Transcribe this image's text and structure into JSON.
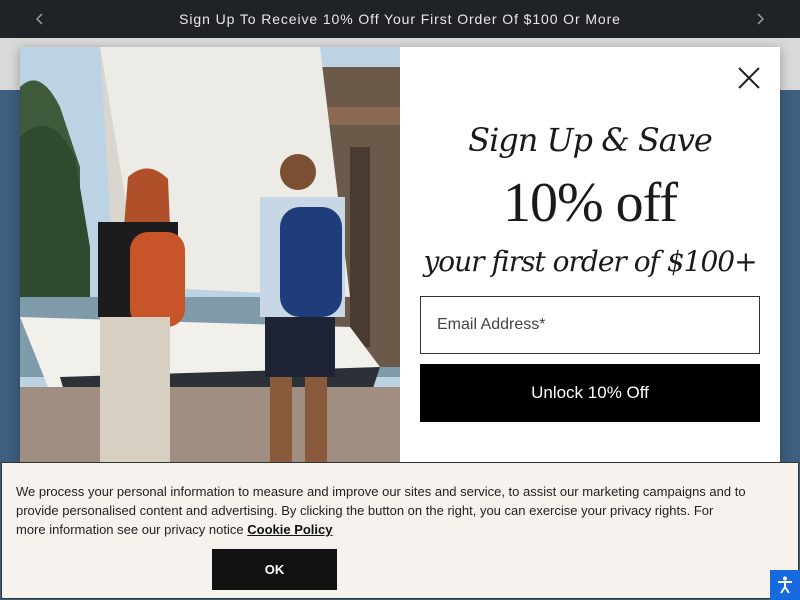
{
  "announcement": {
    "text": "Sign Up To Receive 10% Off Your First Order Of $100 Or More",
    "prev_icon": "chevron-left-icon",
    "next_icon": "chevron-right-icon"
  },
  "modal": {
    "headline": "Sign Up & Save",
    "offer": "10% off",
    "subline": "your first order of $100+",
    "email_placeholder": "Email Address*",
    "submit_label": "Unlock 10% Off",
    "close_icon": "close-icon"
  },
  "cookie_banner": {
    "text": "We process your personal information to measure and improve our sites and service, to assist our marketing campaigns and to provide personalised content and advertising. By clicking the button on the right, you can exercise your privacy rights. For more information see our privacy notice",
    "link_label": "Cookie Policy",
    "ok_label": "OK"
  },
  "accessibility_icon": "accessibility-icon",
  "colors": {
    "announcement_bg": "#1f2328",
    "button_bg": "#000000",
    "cookie_bg": "#f6f2ee",
    "accessibility_bg": "#1769e0"
  }
}
